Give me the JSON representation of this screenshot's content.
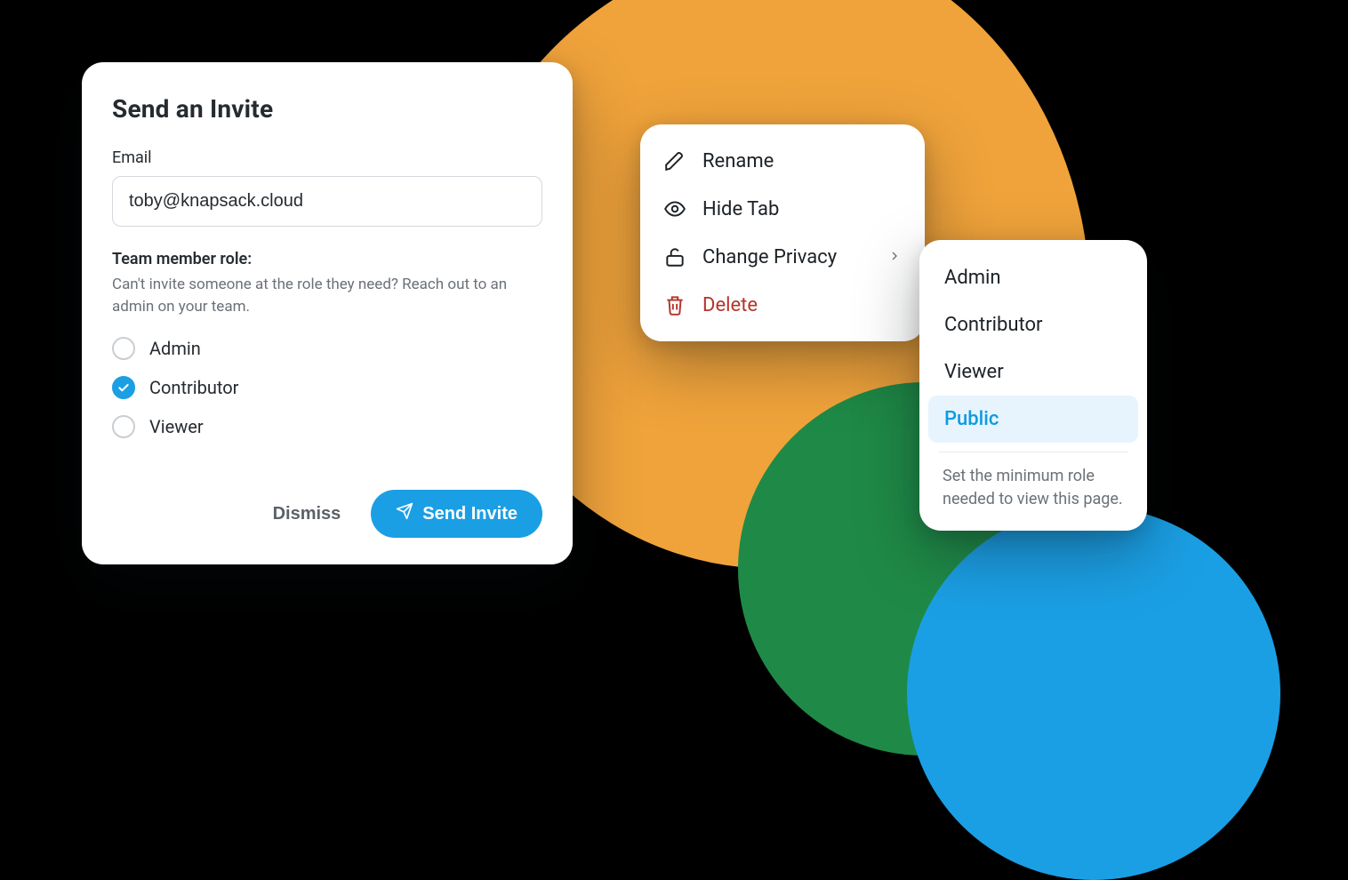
{
  "invite": {
    "title": "Send an Invite",
    "email_label": "Email",
    "email_value": "toby@knapsack.cloud",
    "role_section_title": "Team member role:",
    "role_helper": "Can't invite someone at the role they need? Reach out to an admin on your team.",
    "roles": [
      "Admin",
      "Contributor",
      "Viewer"
    ],
    "selected_role_index": 1,
    "dismiss_label": "Dismiss",
    "send_label": "Send Invite"
  },
  "context_menu": {
    "items": [
      {
        "icon": "pencil-icon",
        "label": "Rename"
      },
      {
        "icon": "eye-icon",
        "label": "Hide Tab"
      },
      {
        "icon": "lock-open-icon",
        "label": "Change Privacy",
        "has_submenu": true
      },
      {
        "icon": "trash-icon",
        "label": "Delete",
        "danger": true
      }
    ]
  },
  "privacy_submenu": {
    "options": [
      "Admin",
      "Contributor",
      "Viewer",
      "Public"
    ],
    "active_index": 3,
    "help_text": "Set the minimum role needed to view this page."
  },
  "colors": {
    "accent": "#1b9fe4",
    "danger": "#b5342a",
    "warning_blob": "#f0a33b",
    "success_blob": "#1f8a47"
  }
}
